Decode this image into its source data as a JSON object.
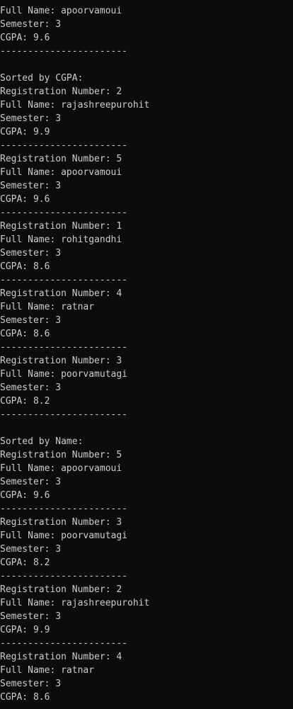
{
  "console": {
    "background_color": "#0c0c0c",
    "text_color": "#cccccc",
    "lines": [
      "Full Name: apoorvamoui",
      "Semester: 3",
      "CGPA: 9.6",
      "-----------------------",
      "",
      "Sorted by CGPA:",
      "Registration Number: 2",
      "Full Name: rajashreepurohit",
      "Semester: 3",
      "CGPA: 9.9",
      "-----------------------",
      "Registration Number: 5",
      "Full Name: apoorvamoui",
      "Semester: 3",
      "CGPA: 9.6",
      "-----------------------",
      "Registration Number: 1",
      "Full Name: rohitgandhi",
      "Semester: 3",
      "CGPA: 8.6",
      "-----------------------",
      "Registration Number: 4",
      "Full Name: ratnar",
      "Semester: 3",
      "CGPA: 8.6",
      "-----------------------",
      "Registration Number: 3",
      "Full Name: poorvamutagi",
      "Semester: 3",
      "CGPA: 8.2",
      "-----------------------",
      "",
      "Sorted by Name:",
      "Registration Number: 5",
      "Full Name: apoorvamoui",
      "Semester: 3",
      "CGPA: 9.6",
      "-----------------------",
      "Registration Number: 3",
      "Full Name: poorvamutagi",
      "Semester: 3",
      "CGPA: 8.2",
      "-----------------------",
      "Registration Number: 2",
      "Full Name: rajashreepurohit",
      "Semester: 3",
      "CGPA: 9.9",
      "-----------------------",
      "Registration Number: 4",
      "Full Name: ratnar",
      "Semester: 3",
      "CGPA: 8.6"
    ]
  }
}
